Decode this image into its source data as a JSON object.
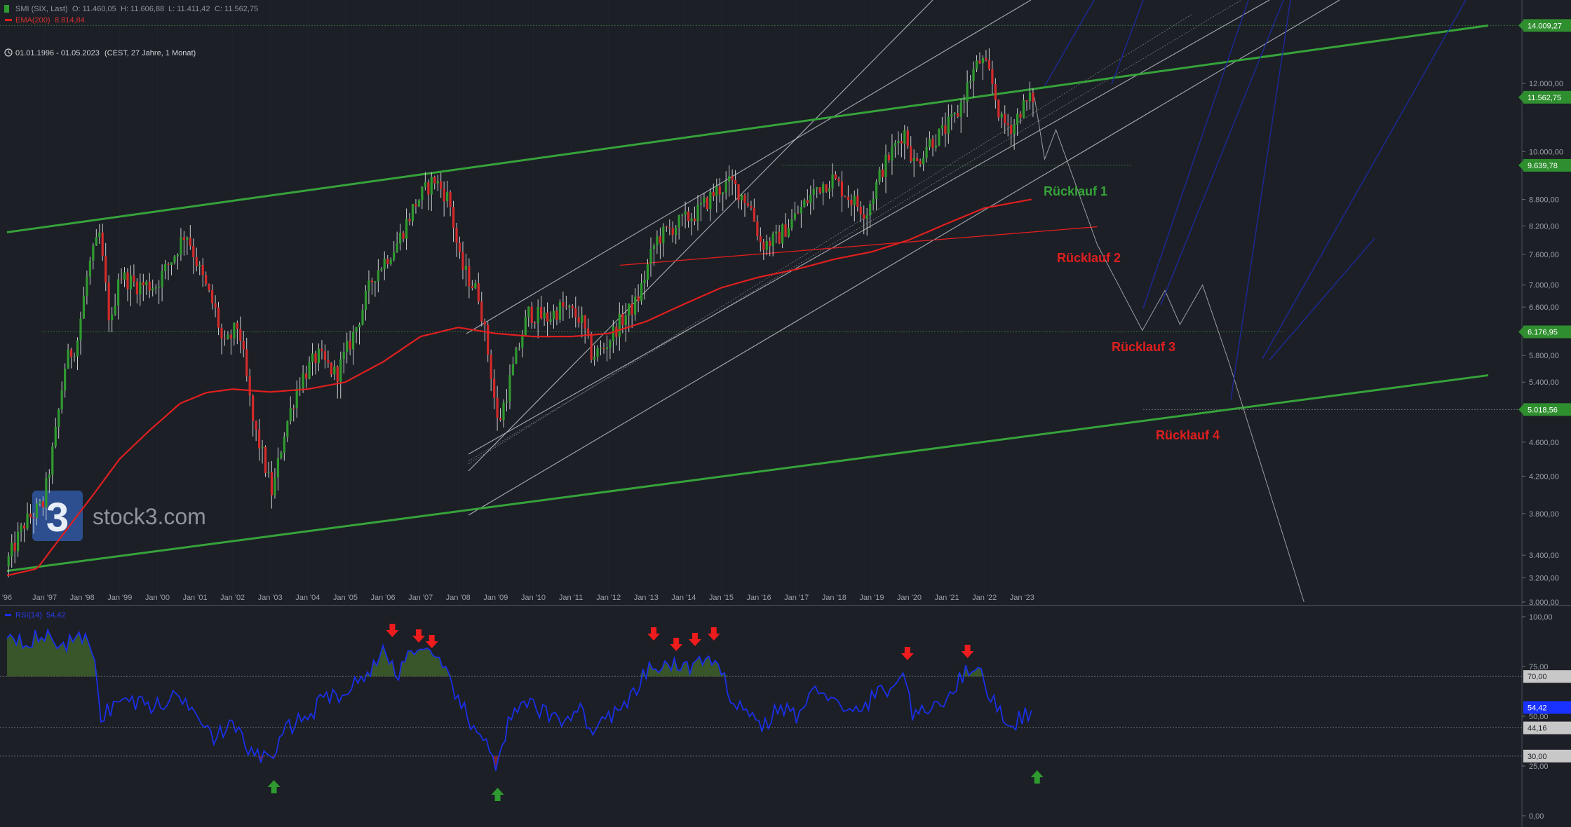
{
  "header": {
    "symbol_line": "SMI (SIX, Last)",
    "ohlc": {
      "o": "O: 11.460,05",
      "h": "H: 11.606,88",
      "l": "L: 11.411,42",
      "c": "C: 11.562,75"
    },
    "ema_label": "EMA(200)",
    "ema_value": "8.814,84",
    "range_label": "01.01.1996 - 01.05.2023",
    "range_detail": "(CEST, 27 Jahre, 1 Monat)"
  },
  "logo": {
    "brand": "stock3.com",
    "glyph": "3"
  },
  "colors": {
    "bg": "#1c1f26",
    "up": "#2f9a2f",
    "down": "#d42a2a",
    "ema": "#e01f1f",
    "trend_green": "#36a33a",
    "rsi": "#1a2fe6",
    "grid": "#2c3038",
    "axis_text": "#9aa0a6",
    "label_green_bg": "#2f8f2f",
    "label_blue_bg": "#1a32ff",
    "label_grey_bg": "#c8c8c8"
  },
  "annotations": [
    {
      "text": "Rücklauf 1",
      "color": "#36a33a"
    },
    {
      "text": "Rücklauf 2",
      "color": "#e01f1f"
    },
    {
      "text": "Rücklauf 3",
      "color": "#e01f1f"
    },
    {
      "text": "Rücklauf 4",
      "color": "#e01f1f"
    }
  ],
  "chart_data": [
    {
      "type": "candlestick",
      "interval": "1 Monat",
      "y_axis_scale": "log",
      "x_tick_labels": [
        "'96",
        "Jan '97",
        "Jan '98",
        "Jan '99",
        "Jan '00",
        "Jan '01",
        "Jan '02",
        "Jan '03",
        "Jan '04",
        "Jan '05",
        "Jan '06",
        "Jan '07",
        "Jan '08",
        "Jan '09",
        "Jan '10",
        "Jan '11",
        "Jan '12",
        "Jan '13",
        "Jan '14",
        "Jan '15",
        "Jan '16",
        "Jan '17",
        "Jan '18",
        "Jan '19",
        "Jan '20",
        "Jan '21",
        "Jan '22",
        "Jan '23"
      ],
      "x_tick_years": [
        1996,
        1997,
        1998,
        1999,
        2000,
        2001,
        2002,
        2003,
        2004,
        2005,
        2006,
        2007,
        2008,
        2009,
        2010,
        2011,
        2012,
        2013,
        2014,
        2015,
        2016,
        2017,
        2018,
        2019,
        2020,
        2021,
        2022,
        2023
      ],
      "y_tick_labels": [
        "12.000,00",
        "10.000,00",
        "8.800,00",
        "8.200,00",
        "7.600,00",
        "7.000,00",
        "6.600,00",
        "5.800,00",
        "5.400,00",
        "4.600,00",
        "4.200,00",
        "3.800,00",
        "3.400,00",
        "3.200,00",
        "3.000,00"
      ],
      "y_tick_values": [
        12000,
        10000,
        8800,
        8200,
        7600,
        7000,
        6600,
        5800,
        5400,
        4600,
        4200,
        3800,
        3400,
        3200,
        3000
      ],
      "price_labels": [
        {
          "text": "14.009,27",
          "value": 14009.27,
          "style": "green"
        },
        {
          "text": "11.562,75",
          "value": 11562.75,
          "style": "green"
        },
        {
          "text": "9.639,78",
          "value": 9639.78,
          "style": "green"
        },
        {
          "text": "6.176,95",
          "value": 6176.95,
          "style": "green"
        },
        {
          "text": "5.018,56",
          "value": 5018.56,
          "style": "green"
        }
      ],
      "close_anchors": [
        [
          1996.0,
          3300
        ],
        [
          1996.5,
          3700
        ],
        [
          1997.0,
          3900
        ],
        [
          1997.3,
          4600
        ],
        [
          1997.6,
          5700
        ],
        [
          1997.9,
          6000
        ],
        [
          1998.2,
          7300
        ],
        [
          1998.5,
          8000
        ],
        [
          1998.8,
          6200
        ],
        [
          1999.0,
          7200
        ],
        [
          1999.5,
          7000
        ],
        [
          2000.0,
          7000
        ],
        [
          2000.5,
          7600
        ],
        [
          2000.8,
          8100
        ],
        [
          2001.2,
          7200
        ],
        [
          2001.6,
          6500
        ],
        [
          2001.8,
          5900
        ],
        [
          2002.2,
          6300
        ],
        [
          2002.6,
          4800
        ],
        [
          2002.8,
          4500
        ],
        [
          2003.1,
          4000
        ],
        [
          2003.4,
          4700
        ],
        [
          2003.8,
          5400
        ],
        [
          2004.3,
          5800
        ],
        [
          2004.8,
          5500
        ],
        [
          2005.3,
          6200
        ],
        [
          2005.8,
          7200
        ],
        [
          2006.4,
          7800
        ],
        [
          2006.9,
          8700
        ],
        [
          2007.4,
          9300
        ],
        [
          2007.8,
          8800
        ],
        [
          2008.1,
          7400
        ],
        [
          2008.6,
          6800
        ],
        [
          2008.9,
          5600
        ],
        [
          2009.1,
          4800
        ],
        [
          2009.5,
          5600
        ],
        [
          2009.9,
          6500
        ],
        [
          2010.4,
          6400
        ],
        [
          2010.8,
          6600
        ],
        [
          2011.3,
          6400
        ],
        [
          2011.6,
          5800
        ],
        [
          2011.9,
          5900
        ],
        [
          2012.3,
          6300
        ],
        [
          2012.8,
          6700
        ],
        [
          2013.3,
          7900
        ],
        [
          2013.8,
          8200
        ],
        [
          2014.4,
          8500
        ],
        [
          2014.9,
          9000
        ],
        [
          2015.3,
          9200
        ],
        [
          2015.8,
          8700
        ],
        [
          2016.1,
          7800
        ],
        [
          2016.5,
          7900
        ],
        [
          2017.0,
          8400
        ],
        [
          2017.6,
          9100
        ],
        [
          2018.0,
          9300
        ],
        [
          2018.5,
          8800
        ],
        [
          2018.9,
          8500
        ],
        [
          2019.3,
          9500
        ],
        [
          2019.9,
          10600
        ],
        [
          2020.2,
          9600
        ],
        [
          2020.5,
          10200
        ],
        [
          2020.9,
          10500
        ],
        [
          2021.3,
          11000
        ],
        [
          2021.7,
          12300
        ],
        [
          2021.95,
          12800
        ],
        [
          2022.2,
          12200
        ],
        [
          2022.5,
          10800
        ],
        [
          2022.8,
          10700
        ],
        [
          2023.0,
          11200
        ],
        [
          2023.33,
          11562.75
        ]
      ],
      "ema200_anchors": [
        [
          1996.0,
          3220
        ],
        [
          1996.8,
          3280
        ],
        [
          1997.5,
          3600
        ],
        [
          1998.3,
          4000
        ],
        [
          1999.0,
          4400
        ],
        [
          1999.8,
          4750
        ],
        [
          2000.6,
          5100
        ],
        [
          2001.3,
          5250
        ],
        [
          2002.0,
          5300
        ],
        [
          2003.0,
          5260
        ],
        [
          2004.0,
          5300
        ],
        [
          2005.0,
          5400
        ],
        [
          2006.0,
          5700
        ],
        [
          2007.0,
          6100
        ],
        [
          2008.0,
          6250
        ],
        [
          2009.0,
          6150
        ],
        [
          2010.0,
          6100
        ],
        [
          2011.0,
          6100
        ],
        [
          2012.0,
          6150
        ],
        [
          2013.0,
          6350
        ],
        [
          2014.0,
          6650
        ],
        [
          2015.0,
          6950
        ],
        [
          2016.0,
          7150
        ],
        [
          2017.0,
          7300
        ],
        [
          2018.0,
          7500
        ],
        [
          2019.0,
          7650
        ],
        [
          2020.0,
          7900
        ],
        [
          2021.0,
          8250
        ],
        [
          2022.0,
          8600
        ],
        [
          2023.33,
          8814.84
        ]
      ],
      "trendlines": [
        {
          "name": "upper-green-trend",
          "color": "#36a33a",
          "from": [
            1996.0,
            8060
          ],
          "to": [
            2035.4,
            14009.27
          ]
        },
        {
          "name": "lower-green-trend",
          "color": "#36a33a",
          "from": [
            1996.0,
            3260
          ],
          "to": [
            2035.4,
            5500
          ]
        },
        {
          "name": "red-horizontal-trend",
          "color": "#e01f1f",
          "from": [
            2012.3,
            7380
          ],
          "to": [
            2025.0,
            8180
          ]
        }
      ],
      "horizontal_levels": [
        14009.27,
        9639.78,
        6176.95,
        5018.56
      ],
      "scenario_path": [
        [
          2023.33,
          11562.75
        ],
        [
          2023.6,
          9800
        ],
        [
          2023.9,
          10600
        ],
        [
          2025.0,
          7800
        ],
        [
          2026.2,
          6200
        ],
        [
          2026.8,
          6900
        ],
        [
          2027.2,
          6300
        ],
        [
          2027.8,
          7000
        ],
        [
          2028.5,
          5700
        ],
        [
          2030.5,
          3000
        ]
      ],
      "blue_path": [
        [
          2023.3,
          11700
        ],
        [
          2025.3,
          15500
        ]
      ]
    },
    {
      "type": "line",
      "indicator": "RSI(14)",
      "value": "54,42",
      "y_tick_labels": [
        "100,00",
        "75,00",
        "50,00",
        "25,00",
        "0,00"
      ],
      "y_tick_values": [
        100,
        75,
        50,
        25,
        0
      ],
      "y_range": [
        0,
        100
      ],
      "levels": [
        {
          "text": "70,00",
          "value": 70
        },
        {
          "text": "44,16",
          "value": 44.16
        },
        {
          "text": "30,00",
          "value": 30
        }
      ],
      "current_label": {
        "text": "54,42",
        "value": 54.42
      },
      "rsi_anchors": [
        [
          1996.0,
          92
        ],
        [
          1996.5,
          88
        ],
        [
          1997.0,
          90
        ],
        [
          1997.5,
          86
        ],
        [
          1998.0,
          89
        ],
        [
          1998.3,
          85
        ],
        [
          1998.5,
          50
        ],
        [
          1999.0,
          58
        ],
        [
          1999.5,
          57
        ],
        [
          2000.0,
          55
        ],
        [
          2000.5,
          60
        ],
        [
          2001.0,
          55
        ],
        [
          2001.5,
          40
        ],
        [
          2002.0,
          45
        ],
        [
          2002.5,
          32
        ],
        [
          2003.0,
          28
        ],
        [
          2003.5,
          45
        ],
        [
          2004.0,
          50
        ],
        [
          2004.5,
          60
        ],
        [
          2005.0,
          62
        ],
        [
          2005.5,
          70
        ],
        [
          2006.0,
          82
        ],
        [
          2006.4,
          72
        ],
        [
          2006.8,
          85
        ],
        [
          2007.2,
          80
        ],
        [
          2007.5,
          76
        ],
        [
          2008.0,
          60
        ],
        [
          2008.4,
          42
        ],
        [
          2008.9,
          35
        ],
        [
          2009.0,
          25
        ],
        [
          2009.4,
          50
        ],
        [
          2009.9,
          56
        ],
        [
          2010.4,
          50
        ],
        [
          2010.8,
          48
        ],
        [
          2011.2,
          55
        ],
        [
          2011.6,
          42
        ],
        [
          2012.0,
          50
        ],
        [
          2012.5,
          55
        ],
        [
          2013.0,
          72
        ],
        [
          2013.5,
          76
        ],
        [
          2014.0,
          74
        ],
        [
          2014.5,
          78
        ],
        [
          2015.0,
          72
        ],
        [
          2015.2,
          62
        ],
        [
          2015.8,
          50
        ],
        [
          2016.1,
          45
        ],
        [
          2016.6,
          55
        ],
        [
          2017.0,
          50
        ],
        [
          2017.6,
          65
        ],
        [
          2017.9,
          60
        ],
        [
          2018.3,
          50
        ],
        [
          2018.8,
          55
        ],
        [
          2019.2,
          62
        ],
        [
          2019.6,
          66
        ],
        [
          2019.95,
          70
        ],
        [
          2020.1,
          48
        ],
        [
          2020.6,
          55
        ],
        [
          2021.0,
          60
        ],
        [
          2021.5,
          72
        ],
        [
          2021.75,
          77
        ],
        [
          2022.1,
          62
        ],
        [
          2022.5,
          50
        ],
        [
          2022.7,
          45
        ],
        [
          2023.0,
          50
        ],
        [
          2023.33,
          54.42
        ]
      ],
      "overbought_markers": [
        2006.25,
        2006.95,
        2007.3,
        2013.2,
        2013.8,
        2014.3,
        2014.8,
        2019.95,
        2021.55
      ],
      "oversold_markers": [
        2003.1,
        2009.05,
        2023.4
      ]
    }
  ]
}
